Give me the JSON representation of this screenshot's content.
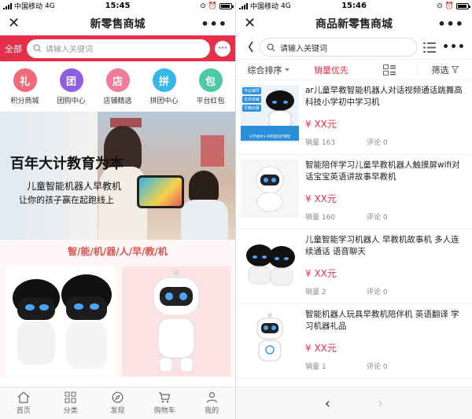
{
  "status_bar": {
    "carrier": "中国移动",
    "network": "4G",
    "left_time": "15:45",
    "right_time": "15:46"
  },
  "left_screen": {
    "title": "新零售商城",
    "close_glyph": "✕",
    "more_glyph": "•••",
    "search": {
      "category_label": "全部",
      "placeholder": "请输入关键词"
    },
    "nav_items": [
      {
        "label": "积分商城",
        "icon": "gift-icon",
        "color": "#f06b7a"
      },
      {
        "label": "团购中心",
        "icon": "group-buy-icon",
        "color": "#8e5fe0"
      },
      {
        "label": "店铺精选",
        "icon": "store-icon",
        "color": "#f07c9a"
      },
      {
        "label": "拼团中心",
        "icon": "puzzle-icon",
        "color": "#35b7e8"
      },
      {
        "label": "平台红包",
        "icon": "red-packet-icon",
        "color": "#4ec9a6"
      }
    ],
    "icon_glyphs": [
      "礼",
      "团",
      "店",
      "拼",
      "包"
    ],
    "banner": {
      "headline": "百年大计教育为本",
      "line2": "儿童智能机器人早教机",
      "line3": "让你的孩子赢在起跑线上"
    },
    "section_heading": "智/能/机/器/人/早/教/机",
    "tabbar": [
      {
        "label": "首页",
        "icon": "home-icon"
      },
      {
        "label": "分类",
        "icon": "grid-icon"
      },
      {
        "label": "发现",
        "icon": "compass-icon"
      },
      {
        "label": "购物车",
        "icon": "cart-icon"
      },
      {
        "label": "我的",
        "icon": "user-icon"
      }
    ]
  },
  "right_screen": {
    "title": "商品新零售商城",
    "close_glyph": "✕",
    "more_glyph": "•••",
    "back_glyph": "〈",
    "search_placeholder": "请输入关键词",
    "filters": {
      "sort": "综合排序",
      "sales": "销量优先",
      "filter": "筛选"
    },
    "products": [
      {
        "title": "ar儿童早教智能机器人对话视频通话跳舞高科技小学初中学习机",
        "price": "¥ XX元",
        "sales": "销量 163",
        "comments": "评论 0",
        "badges": [
          "作业辅导",
          "名师讲解",
          "早教启蒙",
          "小学初中1-9年级同步课程"
        ]
      },
      {
        "title": "智能陪伴学习儿童早教机器人触摸屏wifi对话宝宝英语讲故事早教机",
        "price": "¥ XX元",
        "sales": "销量 160",
        "comments": "评论 0"
      },
      {
        "title": "儿童智能学习机器人 早教机故事机 多人连续通话 语音聊天",
        "price": "¥ XX元",
        "sales": "销量 2",
        "comments": "评论 0"
      },
      {
        "title": "智能机器人玩具早教机陪伴机 英语翻译 学习机器礼品",
        "price": "¥ XX元",
        "sales": "销量 1",
        "comments": "评论 0"
      }
    ],
    "prev_glyph": "‹",
    "next_glyph": "›"
  },
  "colors": {
    "accent_red": "#e62f4a"
  }
}
